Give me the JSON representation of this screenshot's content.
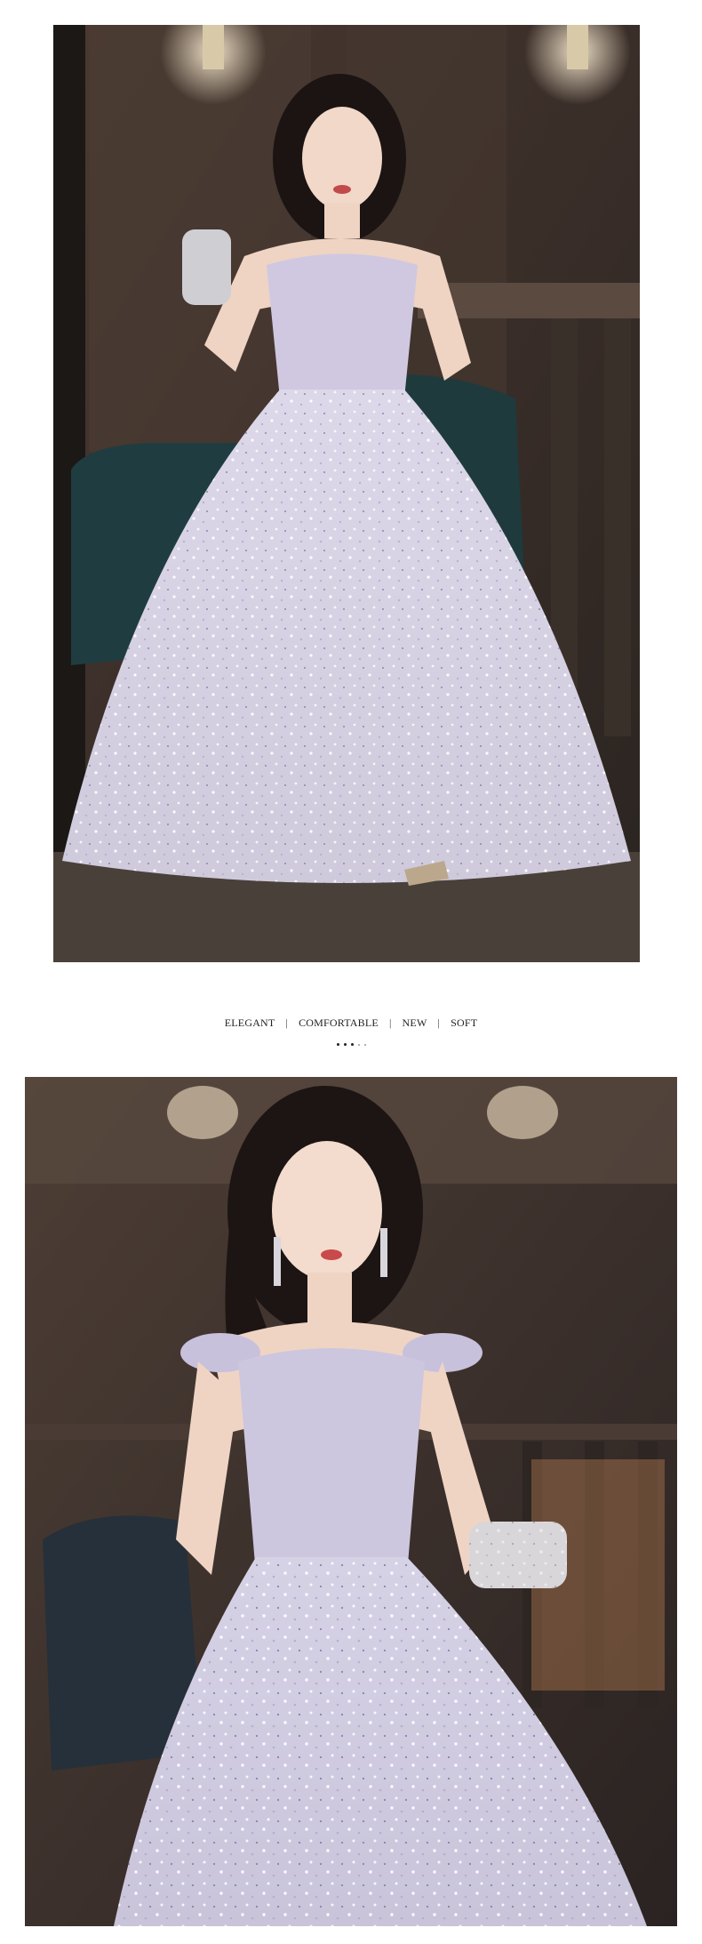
{
  "photos": {
    "top": {
      "subject": "woman-in-lavender-sequin-ball-gown",
      "palette": {
        "background": "#3a2f2a",
        "dress": "#d9d4e4",
        "sparkle": "#f4f1fa",
        "chair": "#1e3b3d"
      }
    },
    "bottom": {
      "subject": "woman-in-lavender-sequin-ball-gown-closeup",
      "palette": {
        "background": "#3b302c",
        "dress": "#cfcbe0",
        "sparkle": "#f6f4fb",
        "clutch": "#d8d6d8"
      }
    }
  },
  "tagline": {
    "items": [
      "ELEGANT",
      "COMFORTABLE",
      "NEW",
      "SOFT"
    ],
    "separator": "|"
  },
  "dots": {
    "count": 5
  }
}
